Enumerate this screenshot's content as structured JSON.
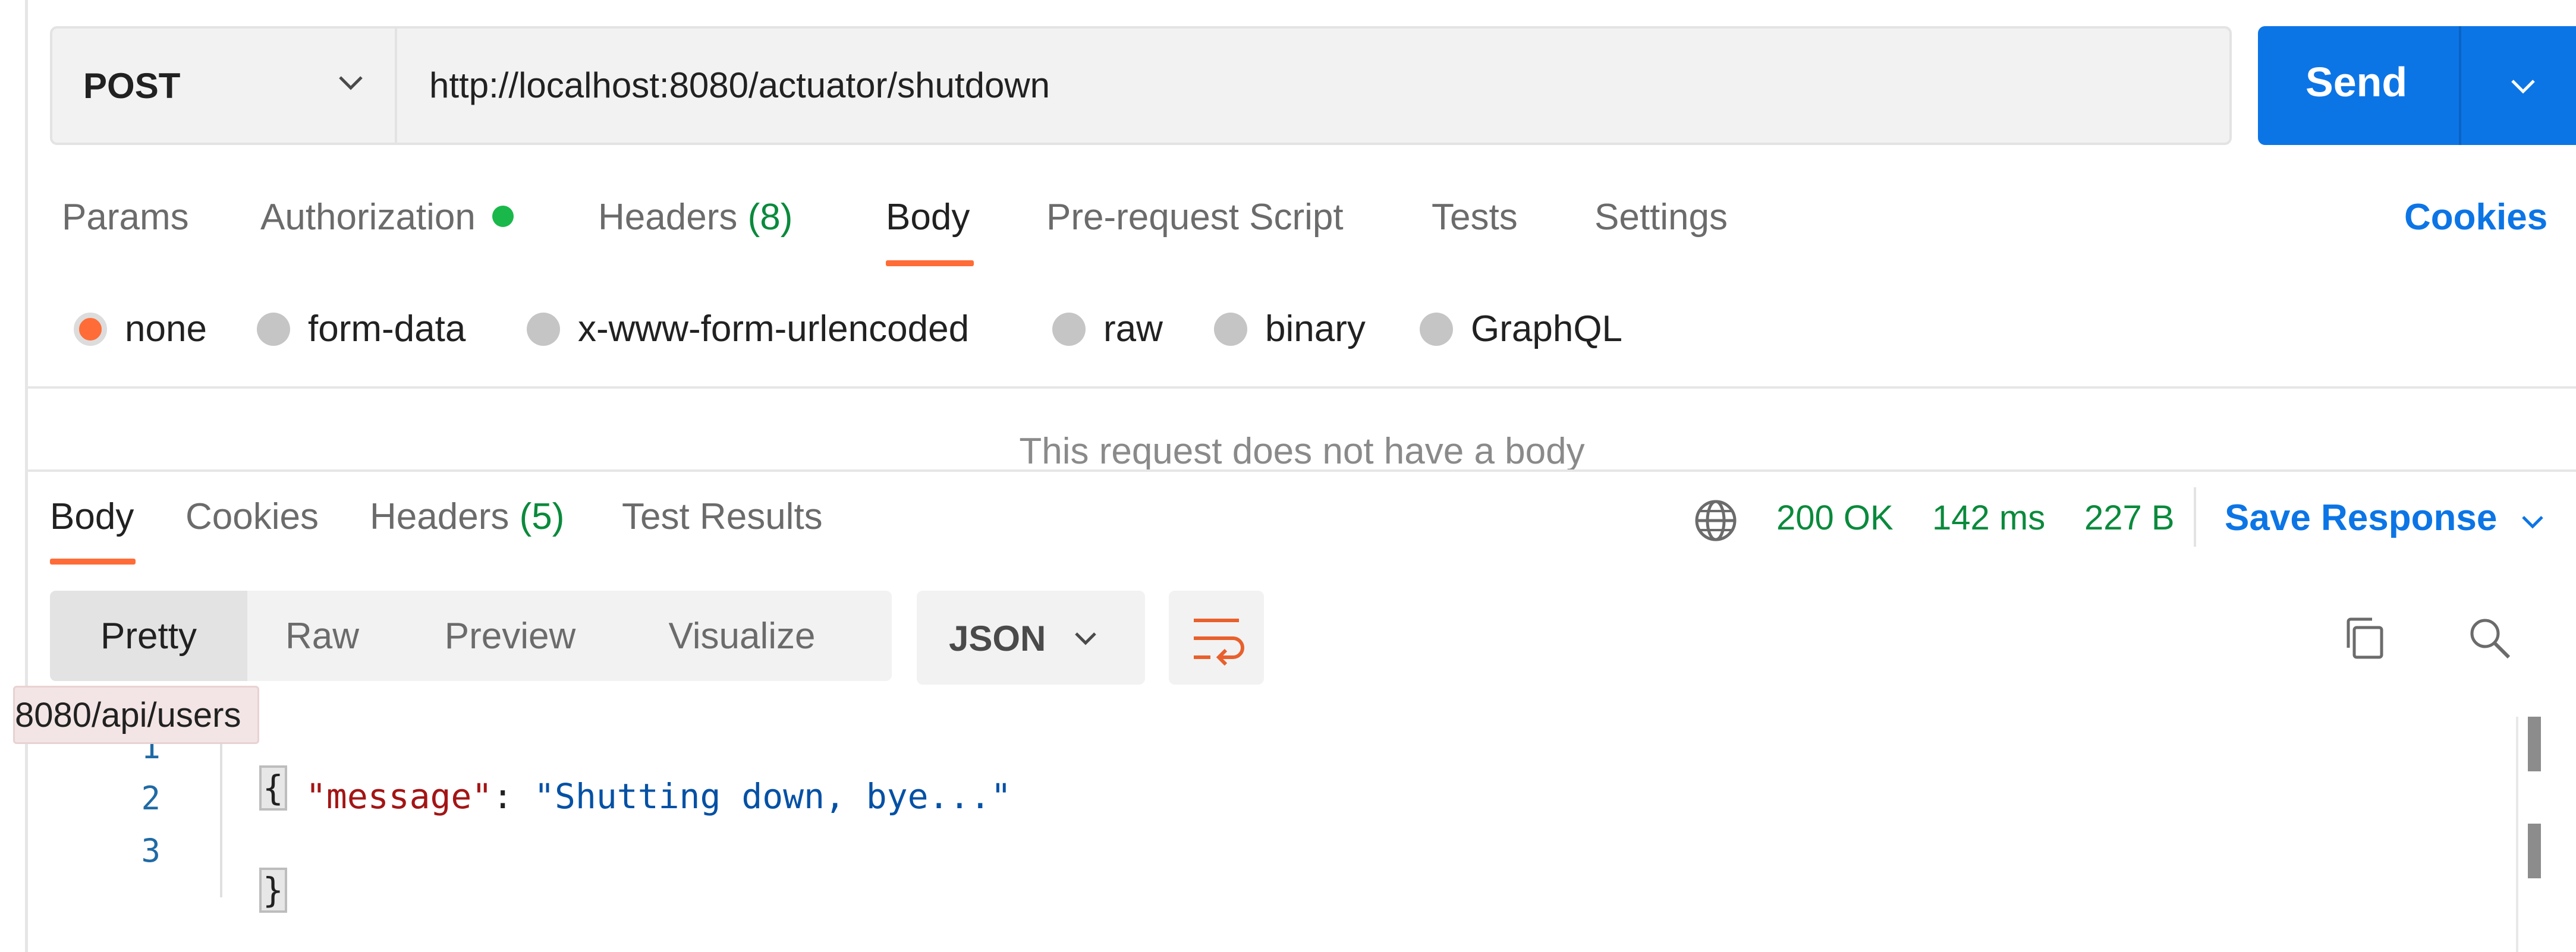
{
  "request": {
    "method": "POST",
    "url": "http://localhost:8080/actuator/shutdown",
    "send_label": "Send"
  },
  "request_tabs": {
    "params": "Params",
    "authorization": "Authorization",
    "headers": "Headers",
    "headers_count": "(8)",
    "body": "Body",
    "pre_request_script": "Pre-request Script",
    "tests": "Tests",
    "settings": "Settings",
    "active": "Body",
    "cookies": "Cookies"
  },
  "body_types": {
    "options": [
      "none",
      "form-data",
      "x-www-form-urlencoded",
      "raw",
      "binary",
      "GraphQL"
    ],
    "selected": "none",
    "empty_message": "This request does not have a body"
  },
  "response_tabs": {
    "body": "Body",
    "cookies": "Cookies",
    "headers": "Headers",
    "headers_count": "(5)",
    "test_results": "Test Results",
    "active": "Body"
  },
  "response_meta": {
    "status": "200 OK",
    "time": "142 ms",
    "size": "227 B",
    "save_response": "Save Response"
  },
  "view": {
    "modes": [
      "Pretty",
      "Raw",
      "Preview",
      "Visualize"
    ],
    "active_mode": "Pretty",
    "format": "JSON"
  },
  "tooltip": "8080/api/users",
  "response_body": {
    "line_numbers": [
      "1",
      "2",
      "3"
    ],
    "open_brace": "{",
    "key": "\"message\"",
    "separator": ": ",
    "value": "\"Shutting down, bye...\"",
    "close_brace": "}"
  },
  "colors": {
    "accent_orange": "#ff6c37",
    "primary_blue": "#0c75e6",
    "success_green": "#0a8a3c",
    "json_key": "#a31515",
    "json_string": "#0451a5"
  },
  "icons": [
    "chevron-down-icon",
    "globe-icon",
    "copy-icon",
    "search-icon",
    "wrap-lines-icon"
  ]
}
